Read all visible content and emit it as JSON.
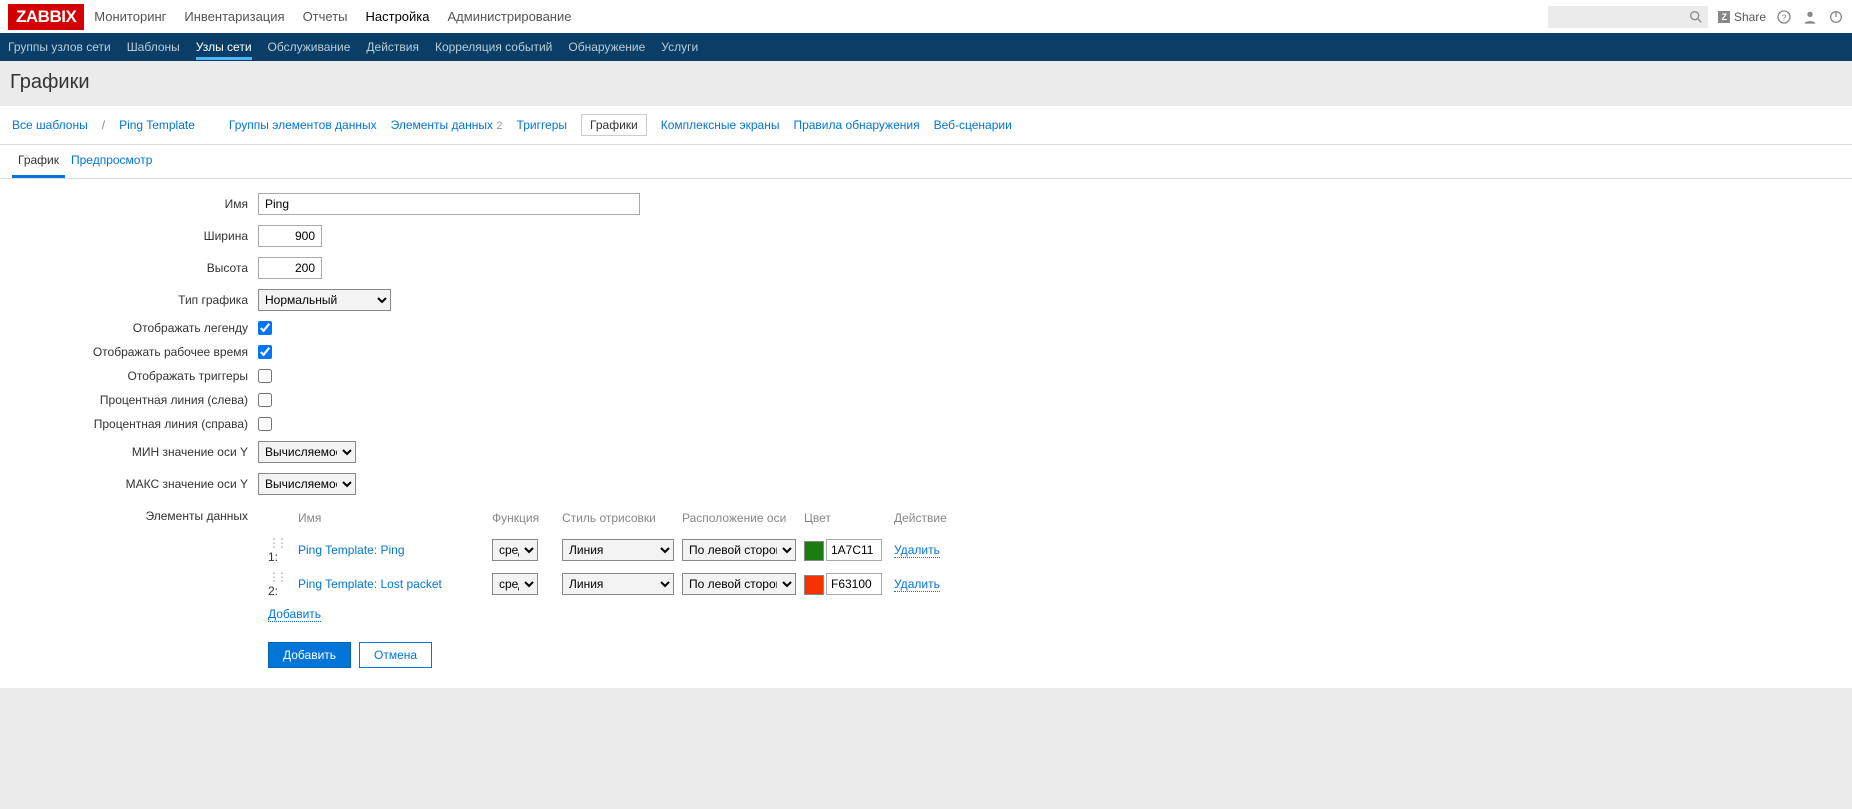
{
  "logo": "ZABBIX",
  "topnav": [
    "Мониторинг",
    "Инвентаризация",
    "Отчеты",
    "Настройка",
    "Администрирование"
  ],
  "topnav_active": 3,
  "share": "Share",
  "subnav": [
    "Группы узлов сети",
    "Шаблоны",
    "Узлы сети",
    "Обслуживание",
    "Действия",
    "Корреляция событий",
    "Обнаружение",
    "Услуги"
  ],
  "subnav_active": 2,
  "page_title": "Графики",
  "breadcrumbs": {
    "all": "Все шаблоны",
    "template": "Ping Template"
  },
  "filters": [
    {
      "label": "Группы элементов данных"
    },
    {
      "label": "Элементы данных",
      "count": "2"
    },
    {
      "label": "Триггеры"
    },
    {
      "label": "Графики",
      "active": true
    },
    {
      "label": "Комплексные экраны"
    },
    {
      "label": "Правила обнаружения"
    },
    {
      "label": "Веб-сценарии"
    }
  ],
  "tabs": [
    "График",
    "Предпросмотр"
  ],
  "tabs_active": 0,
  "form": {
    "name_label": "Имя",
    "name_value": "Ping",
    "width_label": "Ширина",
    "width_value": "900",
    "height_label": "Высота",
    "height_value": "200",
    "type_label": "Тип графика",
    "type_value": "Нормальный",
    "legend_label": "Отображать легенду",
    "legend_checked": true,
    "worktime_label": "Отображать рабочее время",
    "worktime_checked": true,
    "triggers_label": "Отображать триггеры",
    "triggers_checked": false,
    "pleft_label": "Процентная линия (слева)",
    "pleft_checked": false,
    "pright_label": "Процентная линия (справа)",
    "pright_checked": false,
    "ymin_label": "МИН значение оси Y",
    "ymin_value": "Вычисляемое",
    "ymax_label": "МАКС значение оси Y",
    "ymax_value": "Вычисляемое",
    "items_label": "Элементы данных"
  },
  "items_header": {
    "name": "Имя",
    "func": "Функция",
    "style": "Стиль отрисовки",
    "axis": "Расположение оси",
    "color": "Цвет",
    "action": "Действие"
  },
  "items": [
    {
      "num": "1:",
      "name": "Ping Template: Ping",
      "func": "сред",
      "style": "Линия",
      "axis": "По левой стороне",
      "color": "1A7C11",
      "swatch": "#1A7C11",
      "action": "Удалить"
    },
    {
      "num": "2:",
      "name": "Ping Template: Lost packet",
      "func": "сред",
      "style": "Линия",
      "axis": "По левой стороне",
      "color": "F63100",
      "swatch": "#F63100",
      "action": "Удалить"
    }
  ],
  "add_item": "Добавить",
  "submit": "Добавить",
  "cancel": "Отмена"
}
